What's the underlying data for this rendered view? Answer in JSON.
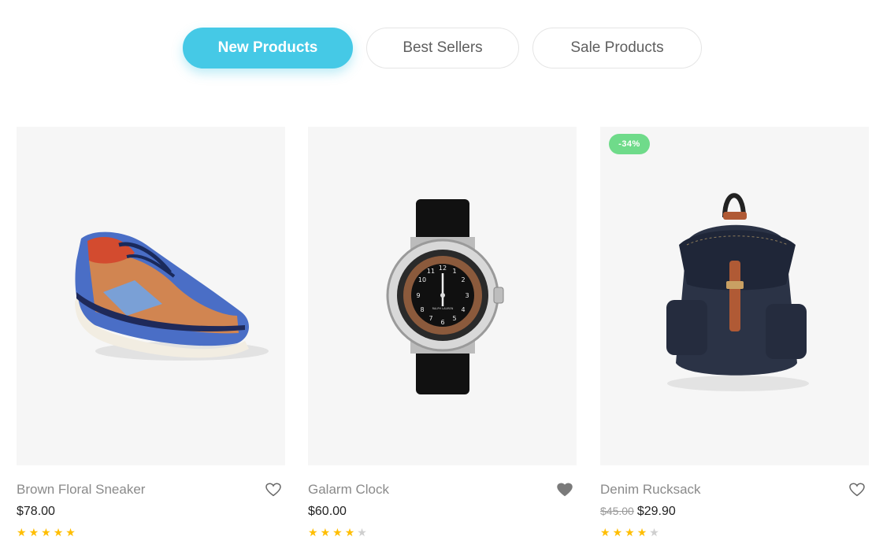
{
  "tabs": [
    {
      "label": "New Products",
      "active": true
    },
    {
      "label": "Best Sellers",
      "active": false
    },
    {
      "label": "Sale Products",
      "active": false
    }
  ],
  "products": [
    {
      "name": "Brown Floral Sneaker",
      "price": "$78.00",
      "old_price": "",
      "rating": 5,
      "wishlisted": false,
      "badge": ""
    },
    {
      "name": "Galarm Clock",
      "price": "$60.00",
      "old_price": "",
      "rating": 4,
      "wishlisted": true,
      "badge": ""
    },
    {
      "name": "Denim Rucksack",
      "price": "$29.90",
      "old_price": "$45.00",
      "rating": 4,
      "wishlisted": false,
      "badge": "-34%"
    }
  ],
  "colors": {
    "accent": "#45c9e6",
    "badge": "#6fdb8a",
    "star": "#ffbe00"
  },
  "watch_face": {
    "brand_text": "RALPH LAUREN",
    "numbers": [
      "12",
      "1",
      "2",
      "3",
      "4",
      "5",
      "6",
      "7",
      "8",
      "9",
      "10",
      "11"
    ]
  }
}
